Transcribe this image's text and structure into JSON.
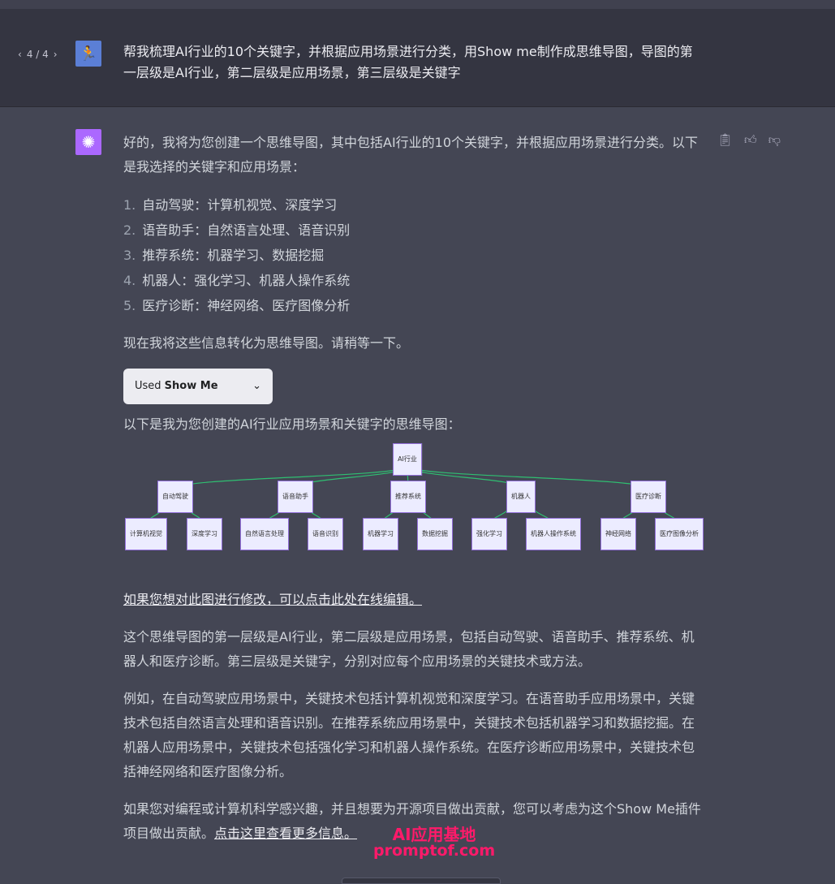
{
  "user_message": {
    "pager": "4 / 4",
    "text": "帮我梳理AI行业的10个关键字，并根据应用场景进行分类，用Show me制作成思维导图，导图的第一层级是AI行业，第二层级是应用场景，第三层级是关键字"
  },
  "assistant": {
    "intro": "好的，我将为您创建一个思维导图，其中包括AI行业的10个关键字，并根据应用场景进行分类。以下是我选择的关键字和应用场景：",
    "list": [
      {
        "n": "1.",
        "text": "自动驾驶：计算机视觉、深度学习"
      },
      {
        "n": "2.",
        "text": "语音助手：自然语言处理、语音识别"
      },
      {
        "n": "3.",
        "text": "推荐系统：机器学习、数据挖掘"
      },
      {
        "n": "4.",
        "text": "机器人：强化学习、机器人操作系统"
      },
      {
        "n": "5.",
        "text": "医疗诊断：神经网络、医疗图像分析"
      }
    ],
    "converting": "现在我将这些信息转化为思维导图。请稍等一下。",
    "plugin": {
      "used": "Used ",
      "name": "Show Me"
    },
    "map_intro": "以下是我为您创建的AI行业应用场景和关键字的思维导图：",
    "edit_link": "如果您想对此图进行修改，可以点击此处在线编辑。",
    "p1": "这个思维导图的第一层级是AI行业，第二层级是应用场景，包括自动驾驶、语音助手、推荐系统、机器人和医疗诊断。第三层级是关键字，分别对应每个应用场景的关键技术或方法。",
    "p2": "例如，在自动驾驶应用场景中，关键技术包括计算机视觉和深度学习。在语音助手应用场景中，关键技术包括自然语言处理和语音识别。在推荐系统应用场景中，关键技术包括机器学习和数据挖掘。在机器人应用场景中，关键技术包括强化学习和机器人操作系统。在医疗诊断应用场景中，关键技术包括神经网络和医疗图像分析。",
    "p3": "如果您对编程或计算机科学感兴趣，并且想要为开源项目做出贡献，您可以考虑为这个Show Me插件项目做出贡献。",
    "p3_link": "点击这里查看更多信息。"
  },
  "mindmap": {
    "root": "AI行业",
    "link_color": "#2fbf71",
    "node_fill": "#ececff",
    "node_border": "#9370db",
    "children": [
      {
        "label": "自动驾驶",
        "children": [
          "计算机视觉",
          "深度学习"
        ]
      },
      {
        "label": "语音助手",
        "children": [
          "自然语言处理",
          "语音识别"
        ]
      },
      {
        "label": "推荐系统",
        "children": [
          "机器学习",
          "数据挖掘"
        ]
      },
      {
        "label": "机器人",
        "children": [
          "强化学习",
          "机器人操作系统"
        ]
      },
      {
        "label": "医疗诊断",
        "children": [
          "神经网络",
          "医疗图像分析"
        ]
      }
    ]
  },
  "watermark": {
    "line1": "AI应用基地",
    "line2": "promptof.com"
  }
}
